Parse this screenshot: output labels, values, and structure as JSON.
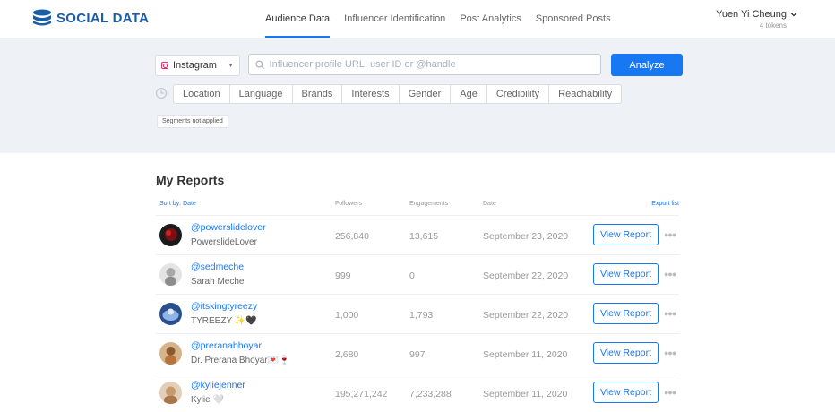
{
  "brand": {
    "name": "SOCIAL DATA",
    "color": "#1a5ea8"
  },
  "nav": {
    "tabs": [
      "Audience Data",
      "Influencer Identification",
      "Post Analytics",
      "Sponsored Posts"
    ],
    "active": "Audience Data"
  },
  "user": {
    "name": "Yuen Yi Cheung",
    "tokens": "4 tokens"
  },
  "search": {
    "platform": "Instagram",
    "placeholder": "Influencer profile URL, user ID or @handle",
    "value": "",
    "analyze_label": "Analyze",
    "filters": [
      "Location",
      "Language",
      "Brands",
      "Interests",
      "Gender",
      "Age",
      "Credibility",
      "Reachability"
    ],
    "segments_badge": "Segments not applied"
  },
  "reports": {
    "title": "My Reports",
    "sort_label": "Sort by: Date",
    "columns": {
      "followers": "Followers",
      "engagements": "Engagements",
      "date": "Date"
    },
    "export_label": "Export list",
    "view_label": "View Report",
    "rows": [
      {
        "handle": "@powerslidelover",
        "name": "PowerslideLover",
        "followers": "256,840",
        "engagements": "13,615",
        "date": "September 23, 2020",
        "avatar": "dark-red"
      },
      {
        "handle": "@sedmeche",
        "name": "Sarah Meche",
        "followers": "999",
        "engagements": "0",
        "date": "September 22, 2020",
        "avatar": "grey"
      },
      {
        "handle": "@itskingtyreezy",
        "name": "TYREEZY ✨🖤",
        "followers": "1,000",
        "engagements": "1,793",
        "date": "September 22, 2020",
        "avatar": "blue"
      },
      {
        "handle": "@preranabhoyar",
        "name": "Dr. Prerana Bhoyar💌🍷",
        "followers": "2,680",
        "engagements": "997",
        "date": "September 11, 2020",
        "avatar": "tan"
      },
      {
        "handle": "@kyliejenner",
        "name": "Kylie 🤍",
        "followers": "195,271,242",
        "engagements": "7,233,288",
        "date": "September 11, 2020",
        "avatar": "beige"
      }
    ]
  },
  "colors": {
    "accent": "#1877f2",
    "panel_bg": "#eef2f7"
  }
}
